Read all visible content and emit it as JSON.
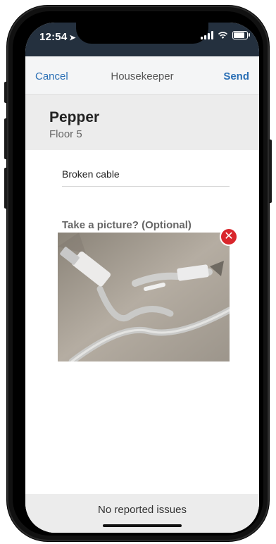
{
  "status_bar": {
    "time": "12:54",
    "signal_bars": 4,
    "battery_level": 0.75
  },
  "nav": {
    "cancel_label": "Cancel",
    "title": "Housekeeper",
    "send_label": "Send"
  },
  "room": {
    "name": "Pepper",
    "floor": "Floor 5"
  },
  "issue": {
    "value": "Broken cable"
  },
  "photo": {
    "label": "Take a picture? (Optional)"
  },
  "footer": {
    "text": "No reported issues"
  },
  "colors": {
    "accent": "#2a6fb5",
    "status_bar": "#24303e",
    "remove": "#d9262c"
  }
}
